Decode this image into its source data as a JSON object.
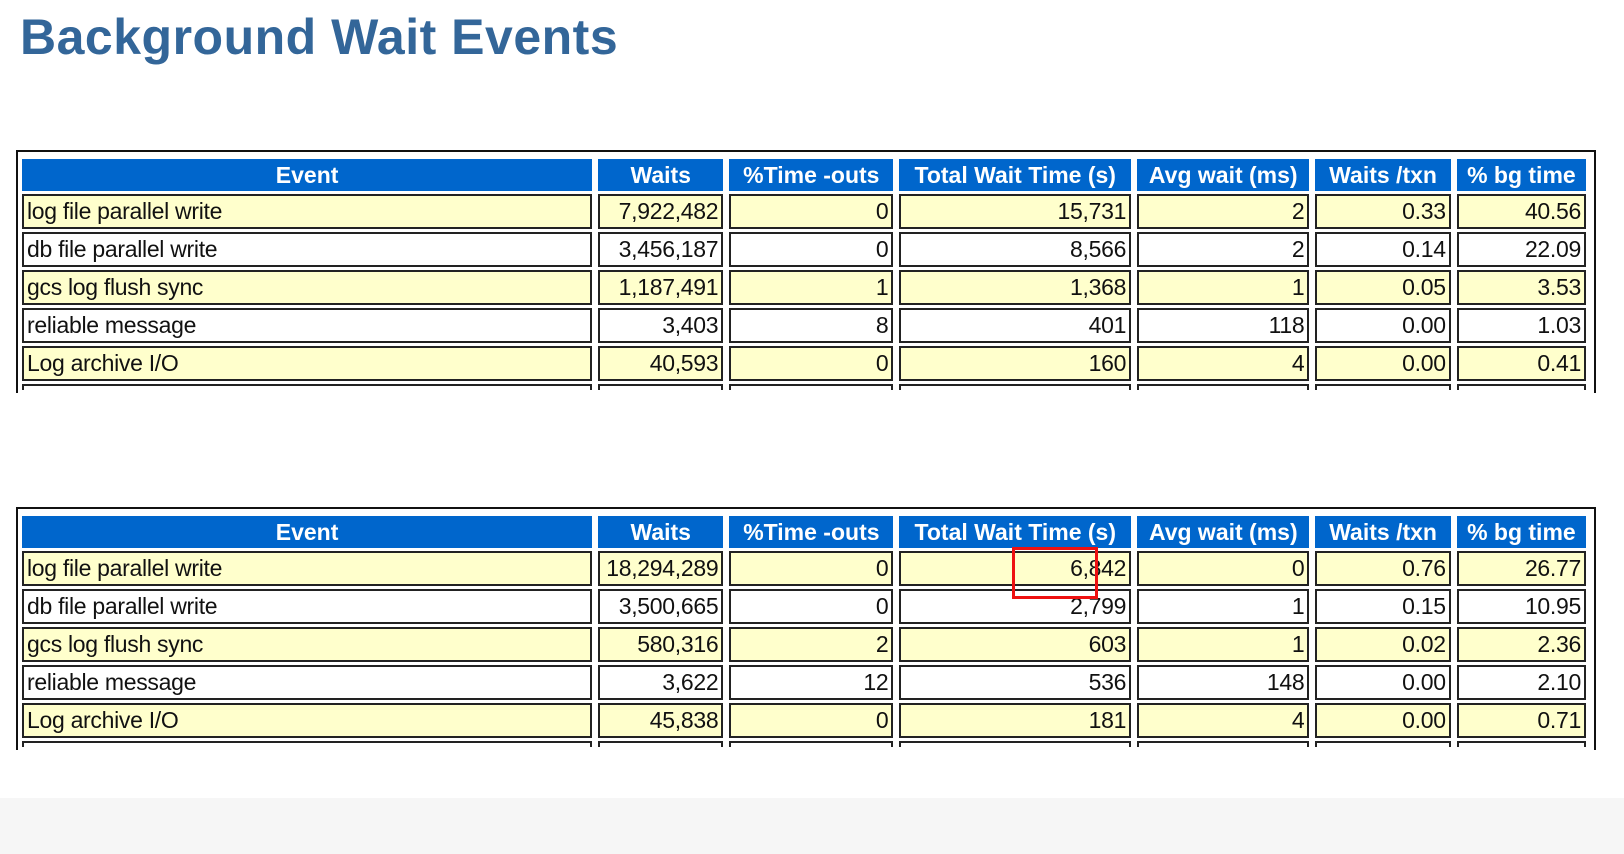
{
  "page": {
    "title": "Background Wait Events"
  },
  "columns": [
    "Event",
    "Waits",
    "%Time -outs",
    "Total Wait Time (s)",
    "Avg wait (ms)",
    "Waits /txn",
    "% bg time"
  ],
  "tables": [
    {
      "rows": [
        [
          "log file parallel write",
          "7,922,482",
          "0",
          "15,731",
          "2",
          "0.33",
          "40.56"
        ],
        [
          "db file parallel write",
          "3,456,187",
          "0",
          "8,566",
          "2",
          "0.14",
          "22.09"
        ],
        [
          "gcs log flush sync",
          "1,187,491",
          "1",
          "1,368",
          "1",
          "0.05",
          "3.53"
        ],
        [
          "reliable message",
          "3,403",
          "8",
          "401",
          "118",
          "0.00",
          "1.03"
        ],
        [
          "Log archive I/O",
          "40,593",
          "0",
          "160",
          "4",
          "0.00",
          "0.41"
        ]
      ]
    },
    {
      "rows": [
        [
          "log file parallel write",
          "18,294,289",
          "0",
          "6,842",
          "0",
          "0.76",
          "26.77"
        ],
        [
          "db file parallel write",
          "3,500,665",
          "0",
          "2,799",
          "1",
          "0.15",
          "10.95"
        ],
        [
          "gcs log flush sync",
          "580,316",
          "2",
          "603",
          "1",
          "0.02",
          "2.36"
        ],
        [
          "reliable message",
          "3,622",
          "12",
          "536",
          "148",
          "0.00",
          "2.10"
        ],
        [
          "Log archive I/O",
          "45,838",
          "0",
          "181",
          "4",
          "0.00",
          "0.71"
        ]
      ]
    }
  ],
  "highlight": {
    "color": "#ee1111",
    "table": 1,
    "row": 0,
    "column": 3
  },
  "colors": {
    "title": "#336699",
    "header_bg": "#0066cc",
    "odd_row_bg": "#ffffcc"
  }
}
